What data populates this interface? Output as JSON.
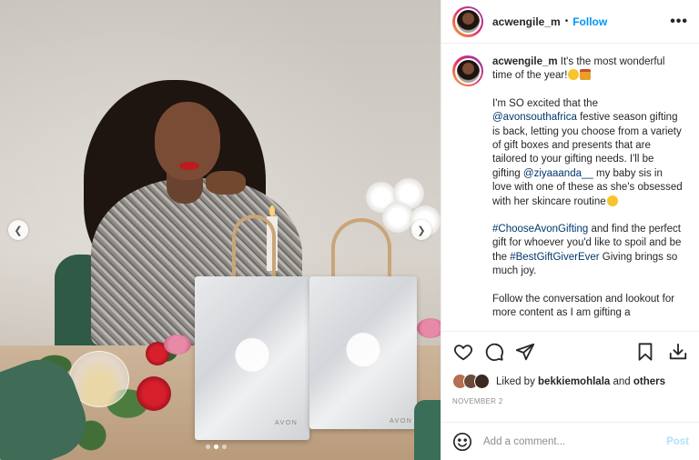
{
  "post": {
    "username": "acwengile_m",
    "separator": "•",
    "follow_label": "Follow",
    "more_label": "•••"
  },
  "caption": {
    "username": "acwengile_m",
    "p1_text": "It's the most wonderful time of the year!",
    "p2_a": "I'm SO excited that the ",
    "p2_link1": "@avonsouthafrica",
    "p2_b": " festive season gifting is back, letting you choose from a variety of gift boxes and presents that are tailored to your gifting needs. I'll be gifting ",
    "p2_link2": "@ziyaaanda__",
    "p2_c": " my baby sis in love with one of these as she's obsessed with her skincare routine",
    "p3_link1": "#ChooseAvonGifting",
    "p3_a": " and find the perfect gift for whoever you'd like to spoil and be the ",
    "p3_link2": "#BestGiftGiverEver",
    "p3_b": " Giving brings so much joy.",
    "p4_text": "Follow the conversation and lookout for more content as I am gifting a"
  },
  "likes": {
    "prefix": "Liked by ",
    "user": "bekkiemohlala",
    "and": " and ",
    "others": "others"
  },
  "date": "NOVEMBER 2",
  "comment": {
    "placeholder": "Add a comment...",
    "post_label": "Post"
  },
  "photo": {
    "brand_left": "AVON",
    "brand_right": "AVON",
    "slide_count": 3,
    "active_slide": 2
  },
  "icons": [
    "heart-icon",
    "comment-icon",
    "share-icon",
    "bookmark-icon",
    "download-icon",
    "smile-icon",
    "chevron-left-icon",
    "chevron-right-icon"
  ],
  "colors": {
    "accent": "#0095f6",
    "link": "#00376b",
    "post_disabled": "#b2dffc",
    "muted": "#8e8e8e"
  }
}
